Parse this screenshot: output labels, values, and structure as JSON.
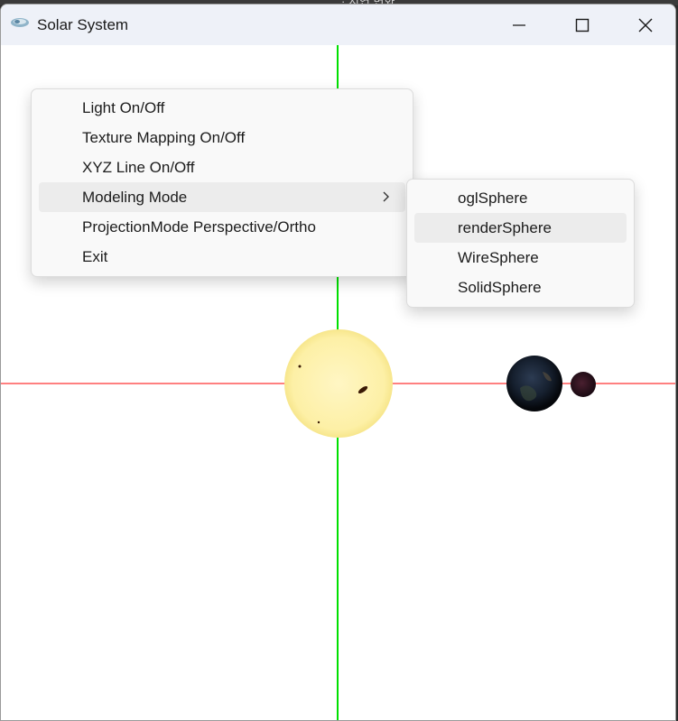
{
  "background_window": {
    "partial_text": "· 지연 변화"
  },
  "window": {
    "title": "Solar System",
    "controls": {
      "minimize_icon": "minimize-icon",
      "maximize_icon": "maximize-icon",
      "close_icon": "close-icon"
    }
  },
  "scene": {
    "x_axis_color": "#ff0000",
    "y_axis_color": "#00e000",
    "background_color": "#ffffff",
    "bodies": [
      "sun",
      "earth",
      "moon"
    ]
  },
  "context_menu": {
    "items": [
      {
        "label": "Light On/Off"
      },
      {
        "label": "Texture Mapping On/Off"
      },
      {
        "label": "XYZ Line On/Off"
      },
      {
        "label": "Modeling Mode",
        "has_submenu": true,
        "highlighted": true
      },
      {
        "label": "ProjectionMode Perspective/Ortho"
      },
      {
        "label": "Exit"
      }
    ]
  },
  "submenu": {
    "items": [
      {
        "label": "oglSphere"
      },
      {
        "label": "renderSphere",
        "highlighted": true
      },
      {
        "label": "WireSphere"
      },
      {
        "label": "SolidSphere"
      }
    ]
  }
}
